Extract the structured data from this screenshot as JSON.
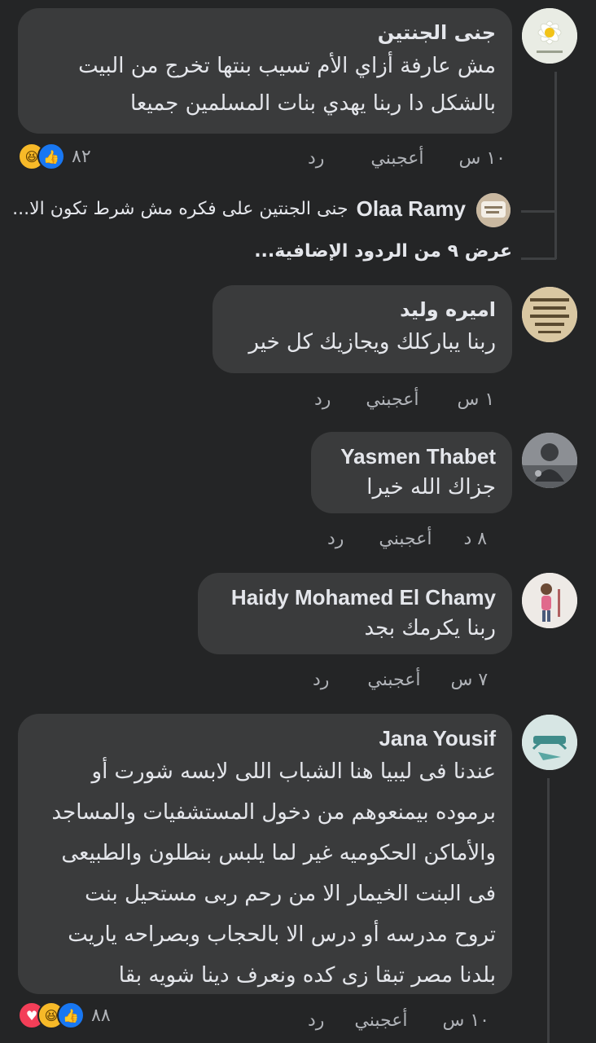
{
  "comments": [
    {
      "author": "جنى الجنتين",
      "lines": [
        "مش عارفة أزاي الأم تسيب بنتها تخرج من البيت",
        "بالشكل دا  ربنا يهدي بنات المسلمين جميعا"
      ],
      "time": "١٠ س",
      "like": "أعجبني",
      "reply": "رد",
      "reaction_count": "٨٢",
      "reactions": [
        "haha",
        "like"
      ]
    },
    {
      "author": "اميره وليد",
      "lines": [
        "ربنا يباركلك ويجازيك كل خير"
      ],
      "time": "١ س",
      "like": "أعجبني",
      "reply": "رد"
    },
    {
      "author": "Yasmen Thabet",
      "lines": [
        "جزاك الله خيرا"
      ],
      "time": "٨ د",
      "like": "أعجبني",
      "reply": "رد"
    },
    {
      "author": "Haidy Mohamed El Chamy",
      "lines": [
        "ربنا يكرمك بجد"
      ],
      "time": "٧ س",
      "like": "أعجبني",
      "reply": "رد"
    },
    {
      "author": "Jana Yousif",
      "lines": [
        "عندنا فى ليبيا هنا  الشباب اللى لابسه شورت أو",
        "برموده بيمنعوهم من دخول المستشفيات والمساجد",
        "والأماكن الحكوميه غير لما يلبس بنطلون والطبيعى",
        "فى البنت الخيمار الا من رحم ربى مستحيل بنت",
        "تروح مدرسه أو درس الا بالحجاب وبصراحه ياريت",
        "بلدنا مصر تبقا زى كده ونعرف دينا شويه بقا"
      ],
      "time": "١٠ س",
      "like": "أعجبني",
      "reply": "رد",
      "reaction_count": "٨٨",
      "reactions": [
        "love",
        "haha",
        "like"
      ]
    }
  ],
  "reply_preview": {
    "author": "Olaa Ramy",
    "text": "جنى الجنتين على فكره مش شرط تكون الا..."
  },
  "more_replies": "عرض ٩ من الردود الإضافية...",
  "colors": {
    "background": "#242526",
    "bubble": "#3a3b3c",
    "text": "#e4e6eb",
    "secondary": "#b0b3b8",
    "like_blue": "#1877f2",
    "haha_yellow": "#f7b928",
    "love_red": "#f33e58"
  }
}
